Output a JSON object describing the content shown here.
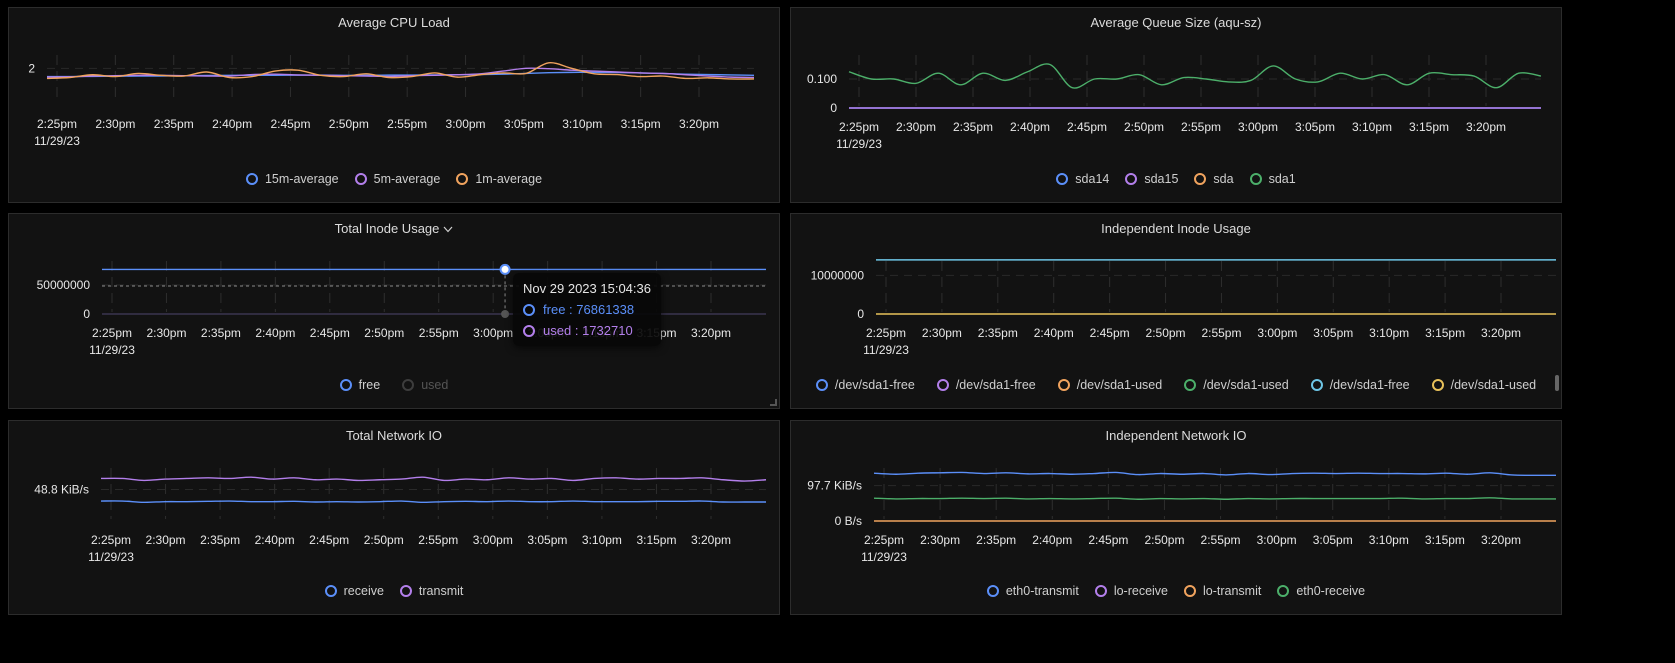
{
  "x_ticks": [
    "2:25pm",
    "2:30pm",
    "2:35pm",
    "2:40pm",
    "2:45pm",
    "2:50pm",
    "2:55pm",
    "3:00pm",
    "3:05pm",
    "3:10pm",
    "3:15pm",
    "3:20pm"
  ],
  "x_date": "11/29/23",
  "colors": {
    "blue": "#5b8ff9",
    "purple": "#b37feb",
    "orange": "#f0a35e",
    "green": "#4caf6a",
    "cyan": "#6ec6e6",
    "yellow": "#e8c15a"
  },
  "chart_data": [
    {
      "id": "cpu",
      "type": "line",
      "title": "Average CPU Load",
      "has_dropdown": false,
      "yticks": [
        {
          "label": "2",
          "value": 2
        }
      ],
      "ylim": [
        0,
        3
      ],
      "xlabel": "",
      "ylabel": "",
      "grid": true,
      "legend": "bottom",
      "series": [
        {
          "name": "15m-average",
          "color": "#5b8ff9",
          "values": [
            1.55,
            1.55,
            1.56,
            1.57,
            1.58,
            1.58,
            1.6,
            1.61,
            1.62,
            1.62,
            1.62,
            1.63,
            1.63,
            1.62,
            1.62,
            1.63,
            1.63,
            1.64,
            1.65,
            1.66,
            1.68,
            1.72,
            1.76,
            1.78,
            1.78,
            1.77,
            1.75,
            1.72,
            1.68,
            1.66,
            1.64,
            1.62
          ]
        },
        {
          "name": "5m-average",
          "color": "#b37feb",
          "values": [
            1.52,
            1.54,
            1.58,
            1.6,
            1.62,
            1.62,
            1.6,
            1.58,
            1.58,
            1.66,
            1.68,
            1.64,
            1.62,
            1.6,
            1.58,
            1.56,
            1.6,
            1.62,
            1.65,
            1.7,
            1.85,
            2.0,
            1.98,
            1.9,
            1.85,
            1.8,
            1.75,
            1.72,
            1.65,
            1.58,
            1.52,
            1.5
          ]
        },
        {
          "name": "1m-average",
          "color": "#f0a35e",
          "values": [
            1.45,
            1.5,
            1.65,
            1.55,
            1.72,
            1.62,
            1.58,
            1.8,
            1.5,
            1.55,
            1.85,
            1.9,
            1.62,
            1.55,
            1.7,
            1.5,
            1.55,
            1.75,
            1.52,
            1.65,
            1.75,
            1.72,
            2.3,
            2.0,
            1.7,
            1.66,
            1.55,
            1.58,
            1.45,
            1.48,
            1.42,
            1.42
          ]
        }
      ]
    },
    {
      "id": "queue",
      "type": "line",
      "title": "Average Queue Size (aqu-sz)",
      "has_dropdown": false,
      "yticks": [
        {
          "label": "0.100",
          "value": 0.1
        },
        {
          "label": "0",
          "value": 0
        }
      ],
      "ylim": [
        0,
        0.2
      ],
      "grid": true,
      "legend": "bottom",
      "series": [
        {
          "name": "sda14",
          "color": "#5b8ff9",
          "values": [
            0,
            0,
            0,
            0,
            0,
            0,
            0,
            0,
            0,
            0,
            0,
            0,
            0,
            0,
            0,
            0,
            0,
            0,
            0,
            0,
            0,
            0,
            0,
            0,
            0,
            0,
            0,
            0,
            0,
            0,
            0,
            0
          ]
        },
        {
          "name": "sda15",
          "color": "#b37feb",
          "values": [
            0,
            0,
            0,
            0,
            0,
            0,
            0,
            0,
            0,
            0,
            0,
            0,
            0,
            0,
            0,
            0,
            0,
            0,
            0,
            0,
            0,
            0,
            0,
            0,
            0,
            0,
            0,
            0,
            0,
            0,
            0,
            0
          ]
        },
        {
          "name": "sda",
          "color": "#f0a35e",
          "values": []
        },
        {
          "name": "sda1",
          "color": "#4caf6a",
          "values": [
            0.125,
            0.1,
            0.1,
            0.085,
            0.12,
            0.08,
            0.12,
            0.095,
            0.125,
            0.15,
            0.07,
            0.1,
            0.1,
            0.115,
            0.08,
            0.105,
            0.1,
            0.09,
            0.095,
            0.145,
            0.1,
            0.09,
            0.12,
            0.1,
            0.115,
            0.08,
            0.12,
            0.115,
            0.11,
            0.07,
            0.12,
            0.11
          ]
        }
      ]
    },
    {
      "id": "total_inode",
      "type": "line",
      "title": "Total Inode Usage",
      "has_dropdown": true,
      "yticks": [
        {
          "label": "50000000",
          "value": 50000000
        },
        {
          "label": "0",
          "value": 0
        }
      ],
      "ylim": [
        0,
        100000000
      ],
      "grid": true,
      "legend": "bottom",
      "series": [
        {
          "name": "free",
          "color": "#5b8ff9",
          "values": [
            76861338,
            76861338
          ],
          "disabled": false
        },
        {
          "name": "used",
          "color": "#b37feb",
          "values": [
            1732710,
            1732710
          ],
          "disabled": true
        }
      ],
      "tooltip": {
        "title": "Nov 29 2023 15:04:36",
        "rows": [
          {
            "label": "free : 76861338",
            "color": "#5b8ff9"
          },
          {
            "label": "used : 1732710",
            "color": "#b37feb"
          }
        ]
      }
    },
    {
      "id": "independent_inode",
      "type": "line",
      "title": "Independent Inode Usage",
      "has_dropdown": false,
      "yticks": [
        {
          "label": "10000000",
          "value": 10000000
        },
        {
          "label": "0",
          "value": 0
        }
      ],
      "ylim": [
        0,
        15000000
      ],
      "grid": true,
      "legend": "bottom",
      "series": [
        {
          "name": "/dev/sda1-free",
          "color": "#5b8ff9",
          "values": []
        },
        {
          "name": "/dev/sda1-free",
          "color": "#b37feb",
          "values": []
        },
        {
          "name": "/dev/sda1-used",
          "color": "#f0a35e",
          "values": []
        },
        {
          "name": "/dev/sda1-used",
          "color": "#4caf6a",
          "values": []
        },
        {
          "name": "/dev/sda1-free",
          "color": "#6ec6e6",
          "values": [
            14000000,
            14000000
          ]
        },
        {
          "name": "/dev/sda1-used",
          "color": "#e8c15a",
          "values": [
            0,
            0
          ]
        }
      ]
    },
    {
      "id": "total_net",
      "type": "line",
      "title": "Total Network IO",
      "has_dropdown": false,
      "yticks": [
        {
          "label": "48.8 KiB/s",
          "value": 48.8
        }
      ],
      "ylim": [
        0,
        90
      ],
      "grid": true,
      "legend": "bottom",
      "series": [
        {
          "name": "receive",
          "color": "#5b8ff9",
          "values": [
            31,
            31,
            29,
            30,
            30,
            30.5,
            31,
            30,
            30,
            30.5,
            29.5,
            30,
            29.5,
            30,
            31,
            29,
            30,
            30.5,
            30,
            31,
            30,
            30,
            31,
            30,
            30,
            30,
            30.5,
            30.5,
            31,
            29.5,
            29.5,
            29.5
          ]
        },
        {
          "name": "transmit",
          "color": "#b37feb",
          "values": [
            66,
            66,
            63,
            65,
            66,
            67,
            66,
            68,
            65,
            67,
            64,
            65,
            63,
            64,
            65,
            68,
            63,
            65,
            64,
            67,
            65,
            66,
            63,
            66,
            67,
            65,
            66,
            66,
            67,
            64,
            62,
            64
          ]
        }
      ]
    },
    {
      "id": "independent_net",
      "type": "line",
      "title": "Independent Network IO",
      "has_dropdown": false,
      "yticks": [
        {
          "label": "97.7 KiB/s",
          "value": 97.7
        },
        {
          "label": "0 B/s",
          "value": 0
        }
      ],
      "ylim": [
        0,
        160
      ],
      "grid": true,
      "legend": "bottom",
      "series": [
        {
          "name": "eth0-transmit",
          "color": "#5b8ff9",
          "values": [
            132,
            129,
            132,
            133,
            134,
            131,
            133,
            130,
            131,
            129,
            131,
            134,
            128,
            131,
            129,
            131,
            127,
            131,
            128,
            131,
            132,
            131,
            132,
            131,
            131,
            130,
            132,
            129,
            133,
            127,
            126,
            126
          ]
        },
        {
          "name": "lo-receive",
          "color": "#b37feb",
          "values": []
        },
        {
          "name": "lo-transmit",
          "color": "#f0a35e",
          "values": [
            0,
            0
          ]
        },
        {
          "name": "eth0-receive",
          "color": "#4caf6a",
          "values": [
            63,
            61,
            62,
            62,
            63,
            62,
            63,
            61,
            62,
            61,
            62,
            63,
            60,
            62,
            61,
            62,
            60,
            62,
            61,
            62,
            62,
            62,
            62,
            62,
            63,
            61,
            62,
            62,
            64,
            61,
            61,
            61
          ]
        }
      ]
    }
  ]
}
